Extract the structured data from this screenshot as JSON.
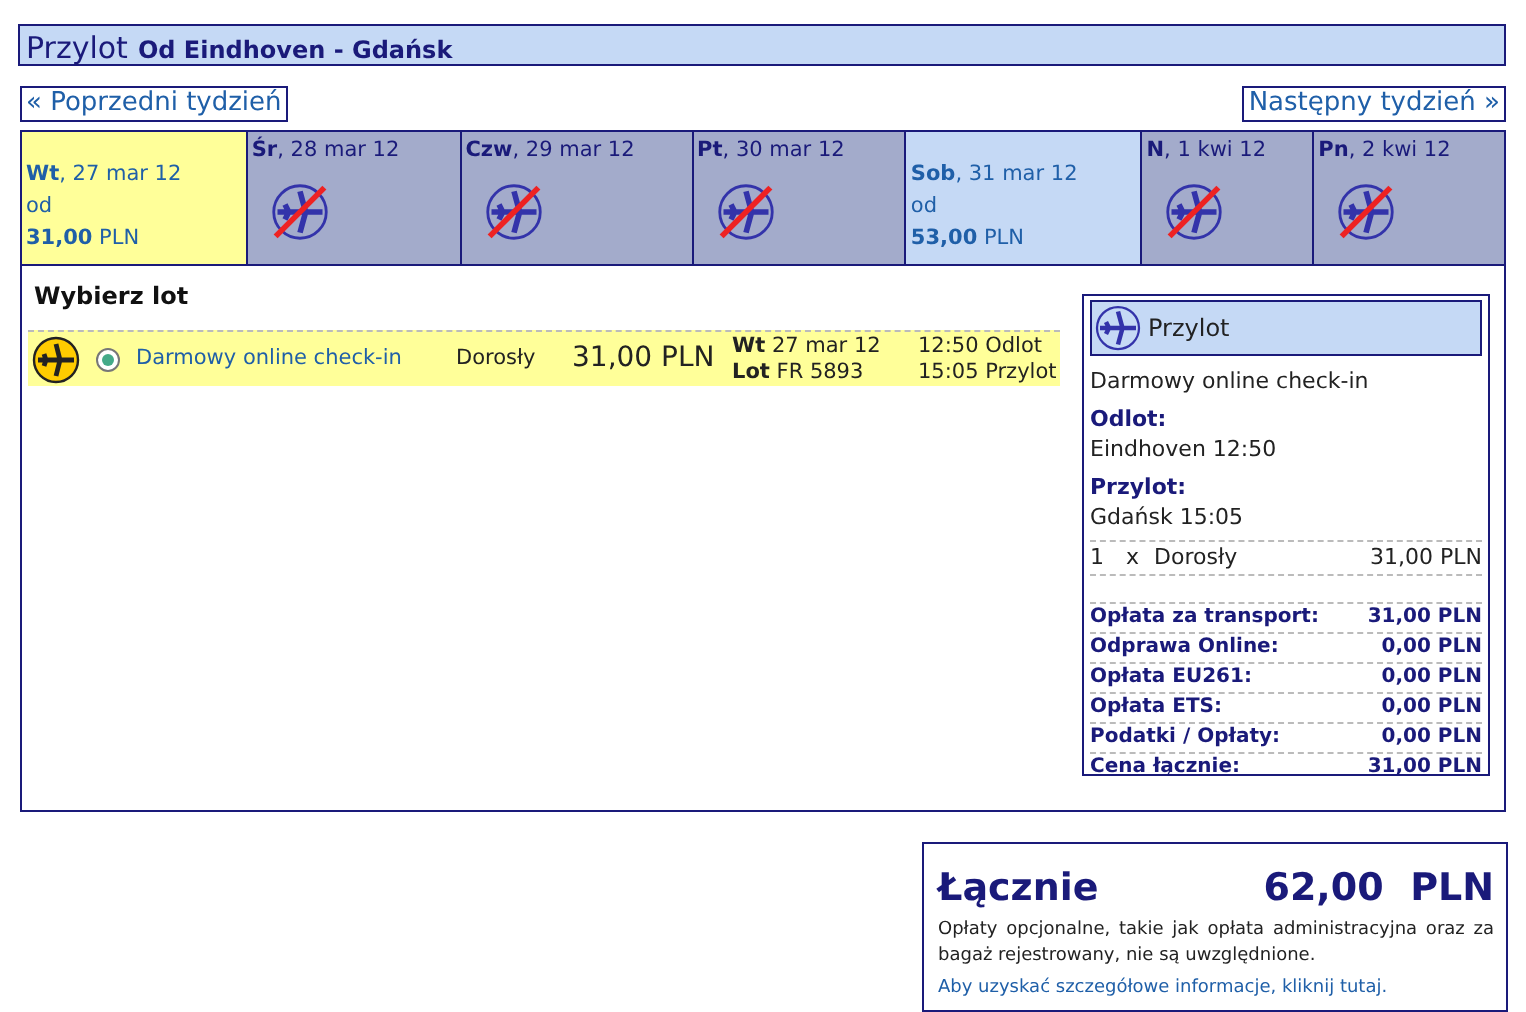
{
  "header": {
    "title": "Przylot",
    "route": "Od Eindhoven - Gdańsk"
  },
  "nav": {
    "previous": "« Poprzedni tydzień",
    "next": "Następny tydzień »"
  },
  "days": [
    {
      "kind": "available",
      "date": "**Wt**, 27 mar 12",
      "from": "od",
      "price": "**31,00** PLN",
      "selected": true
    },
    {
      "kind": "unavailable",
      "date": "**Śr**, 28 mar 12",
      "selected": false
    },
    {
      "kind": "unavailable",
      "date": "**Czw**, 29 mar 12",
      "selected": false
    },
    {
      "kind": "unavailable",
      "date": "**Pt**, 30 mar 12",
      "selected": false
    },
    {
      "kind": "available",
      "date": "**Sob**, 31 mar 12",
      "from": "od",
      "price": "**53,00** PLN",
      "selected": false
    },
    {
      "kind": "unavailable",
      "date": "**N**, 1 kwi 12",
      "selected": false
    },
    {
      "kind": "unavailable",
      "date": "**Pn**, 2 kwi 12",
      "selected": false
    }
  ],
  "choose_title": "Wybierz lot",
  "flights": [
    {
      "fare": "Darmowy online check-in",
      "selected": true,
      "passenger": "Dorosły",
      "price": "31,00 PLN",
      "date": "**Wt** 27 mar 12",
      "flight": "**Lot** FR 5893",
      "departure_time": "12:50",
      "departure_label": "Odlot",
      "arrival_time": "15:05",
      "arrival_label": "Przylot"
    }
  ],
  "summary": {
    "title": "Przylot",
    "fare": "Darmowy online check-in",
    "departure_label": "Odlot:",
    "departure": "Eindhoven 12:50",
    "arrival_label": "Przylot:",
    "arrival": "Gdańsk 15:05",
    "passengers": [
      {
        "count": "1",
        "times": "x",
        "type": "Dorosły",
        "price": "31,00 PLN"
      }
    ],
    "fees": [
      {
        "label": "Opłata za transport:",
        "value": "31,00 PLN"
      },
      {
        "label": "Odprawa Online:",
        "value": "0,00 PLN"
      },
      {
        "label": "Opłata EU261:",
        "value": "0,00 PLN"
      },
      {
        "label": "Opłata ETS:",
        "value": "0,00 PLN"
      },
      {
        "label": "Podatki / Opłaty:",
        "value": "0,00 PLN"
      },
      {
        "label": "Cena łącznie:",
        "value": "31,00 PLN"
      }
    ]
  },
  "total": {
    "label": "Łącznie",
    "amount": "62,00  PLN",
    "note": "Opłaty opcjonalne, takie jak opłata administracyjna oraz za bagaż rejestrowany, nie są uwzględnione.",
    "link": "Aby uzyskać szczegółowe informacje, kliknij tutaj."
  }
}
